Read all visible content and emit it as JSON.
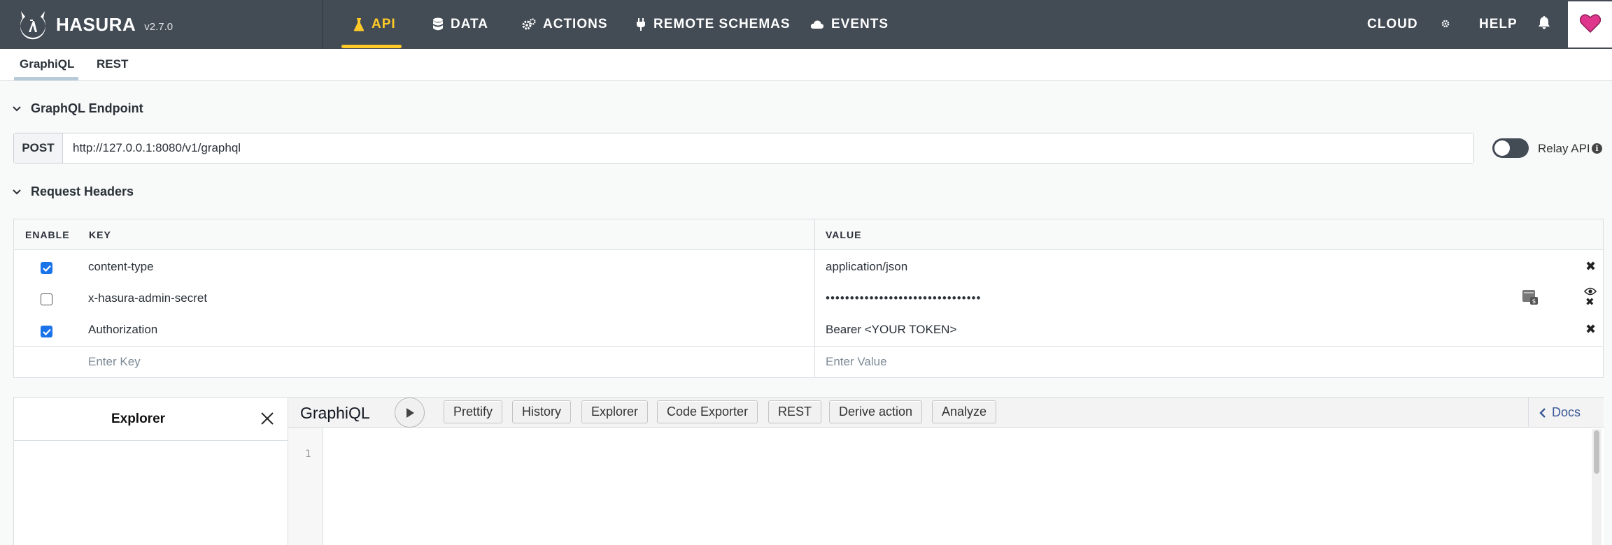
{
  "app": {
    "logo_text": "HASURA",
    "version": "v2.7.0"
  },
  "nav": {
    "items": [
      {
        "label": "API",
        "icon": "flask-icon",
        "active": true
      },
      {
        "label": "DATA",
        "icon": "database-icon"
      },
      {
        "label": "ACTIONS",
        "icon": "gears-icon"
      },
      {
        "label": "REMOTE SCHEMAS",
        "icon": "plug-icon"
      },
      {
        "label": "EVENTS",
        "icon": "cloud-icon"
      }
    ],
    "right": {
      "cloud_label": "CLOUD",
      "help_label": "HELP"
    }
  },
  "subnav": {
    "tabs": [
      {
        "label": "GraphiQL",
        "active": true
      },
      {
        "label": "REST"
      }
    ]
  },
  "endpoint": {
    "section_title": "GraphQL Endpoint",
    "method": "POST",
    "url": "http://127.0.0.1:8080/v1/graphql",
    "relay_label": "Relay API",
    "relay_enabled": false
  },
  "headers": {
    "section_title": "Request Headers",
    "columns": {
      "enable": "ENABLE",
      "key": "KEY",
      "value": "VALUE"
    },
    "rows": [
      {
        "enabled": true,
        "key": "content-type",
        "value": "application/json"
      },
      {
        "enabled": false,
        "key": "x-hasura-admin-secret",
        "value": "••••••••••••••••••••••••••••••••"
      },
      {
        "enabled": true,
        "key": "Authorization",
        "value": "Bearer <YOUR TOKEN>"
      }
    ],
    "new_key_placeholder": "Enter Key",
    "new_value_placeholder": "Enter Value"
  },
  "graphiql": {
    "explorer_title": "Explorer",
    "title": "GraphiQL",
    "toolbar_buttons": [
      "Prettify",
      "History",
      "Explorer",
      "Code Exporter",
      "REST",
      "Derive action",
      "Analyze"
    ],
    "docs_label": "Docs",
    "line_numbers": [
      "1"
    ]
  },
  "colors": {
    "navbar_bg": "#434b55",
    "accent": "#ffca27",
    "checkbox": "#1a73e8",
    "heart": "#e0358c"
  }
}
